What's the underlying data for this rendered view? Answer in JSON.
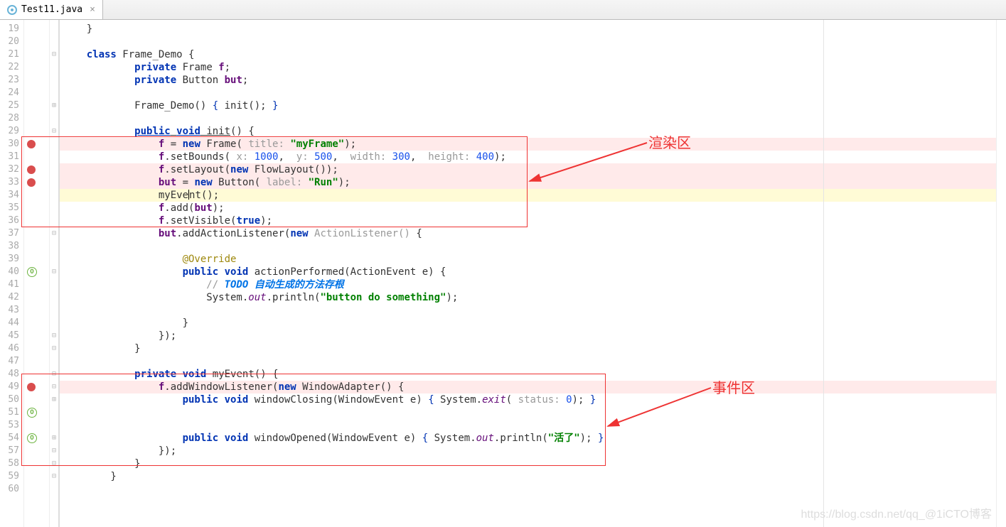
{
  "tab": {
    "filename": "Test11.java"
  },
  "lineNumbers": [
    "19",
    "20",
    "21",
    "22",
    "23",
    "24",
    "25",
    "28",
    "29",
    "30",
    "31",
    "32",
    "33",
    "34",
    "35",
    "36",
    "37",
    "38",
    "39",
    "40",
    "41",
    "42",
    "43",
    "44",
    "45",
    "46",
    "47",
    "48",
    "49",
    "50",
    "51",
    "53",
    "54",
    "57",
    "58",
    "59",
    "60"
  ],
  "markers": {
    "30": "bp",
    "32": "bp",
    "33": "bp",
    "40": "override",
    "49": "bp",
    "51": "override",
    "54": "override"
  },
  "fold": {
    "21": "⊟",
    "25": "⊞",
    "29": "⊟",
    "37": "⊟",
    "40": "⊟",
    "45": "⊟",
    "46": "⊟",
    "48": "⊟",
    "49": "⊟",
    "50": "⊞",
    "54": "⊞",
    "57": "⊟",
    "58": "⊟",
    "59": "⊟"
  },
  "hlRed": [
    "30",
    "32",
    "33",
    "49"
  ],
  "hlYellow": [
    "34"
  ],
  "code": {
    "19": "}",
    "20": "",
    "21": "class Frame_Demo {",
    "22": "private Frame f;",
    "23": "private Button but;",
    "24": "",
    "25": "Frame_Demo() { init(); }",
    "28": "",
    "29": "public void init() {",
    "30": "f = new Frame( title: \"myFrame\");",
    "31": "f.setBounds( x: 1000,  y: 500,  width: 300,  height: 400);",
    "32": "f.setLayout(new FlowLayout());",
    "33": "but = new Button( label: \"Run\");",
    "34": "myEvent();",
    "35": "f.add(but);",
    "36": "f.setVisible(true);",
    "37": "but.addActionListener(new ActionListener() {",
    "38": "",
    "39": "@Override",
    "40": "public void actionPerformed(ActionEvent e) {",
    "41": "// TODO 自动生成的方法存根",
    "42": "System.out.println(\"button do something\");",
    "43": "",
    "44": "}",
    "45": "});",
    "46": "}",
    "47": "",
    "48": "private void myEvent() {",
    "49": "f.addWindowListener(new WindowAdapter() {",
    "50": "public void windowClosing(WindowEvent e) { System.exit( status: 0); }",
    "51": "",
    "53": "",
    "54": "public void windowOpened(WindowEvent e) { System.out.println(\"活了\"); }",
    "57": "});",
    "58": "}",
    "59": "}",
    "60": ""
  },
  "annotations": {
    "box1": {
      "label": "渲染区"
    },
    "box2": {
      "label": "事件区"
    }
  },
  "watermark": "https://blog.csdn.net/qq_@1iCTO博客"
}
